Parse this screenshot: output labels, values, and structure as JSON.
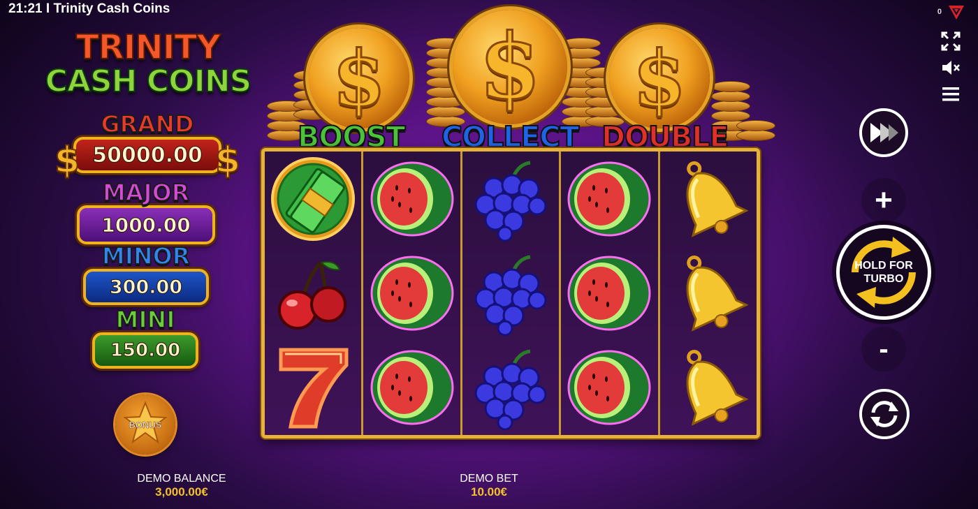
{
  "status_bar": {
    "time": "21:21",
    "separator": "I",
    "title": "Trinity Cash Coins",
    "counter": "0"
  },
  "logo": {
    "line1": "TRINITY",
    "line2": "CASH COINS"
  },
  "jackpots": {
    "grand": {
      "label": "GRAND",
      "value": "50000.00"
    },
    "major": {
      "label": "MAJOR",
      "value": "1000.00"
    },
    "minor": {
      "label": "MINOR",
      "value": "300.00"
    },
    "mini": {
      "label": "MINI",
      "value": "150.00"
    }
  },
  "bonus": {
    "label": "BONUS"
  },
  "features": {
    "boost": "BOOST",
    "collect": "COLLECT",
    "double": "DOUBLE"
  },
  "reels": [
    [
      "cash-stack",
      "cherry",
      "seven"
    ],
    [
      "watermelon",
      "watermelon",
      "watermelon"
    ],
    [
      "grapes",
      "grapes",
      "grapes"
    ],
    [
      "watermelon",
      "watermelon",
      "watermelon"
    ],
    [
      "bell",
      "bell",
      "bell"
    ]
  ],
  "controls": {
    "spin_label_1": "HOLD FOR",
    "spin_label_2": "TURBO",
    "plus": "+",
    "minus": "-"
  },
  "balance": {
    "label": "DEMO BALANCE",
    "value": "3,000.00€"
  },
  "bet": {
    "label": "DEMO BET",
    "value": "10.00€"
  },
  "colors": {
    "gold": "#e6b23a",
    "boost": "#4cc23a",
    "collect": "#1f64e8",
    "double": "#e0302a",
    "value_text": "#f3c12e"
  }
}
